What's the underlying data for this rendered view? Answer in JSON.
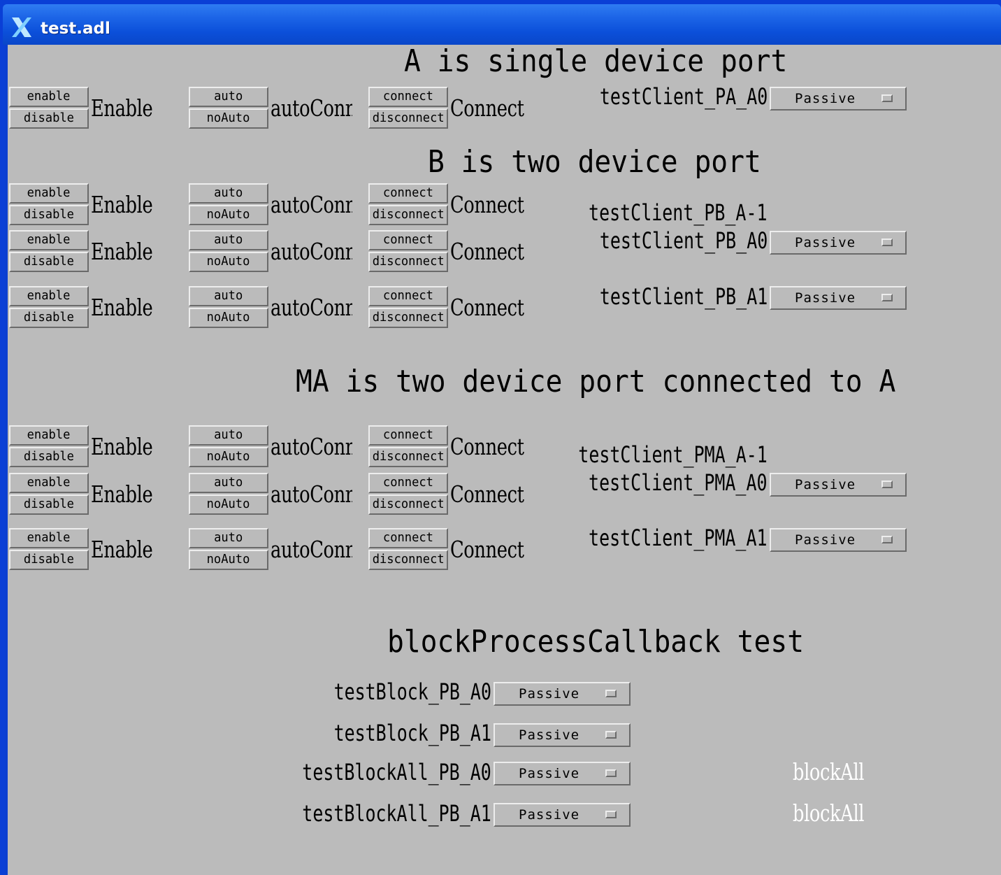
{
  "window": {
    "title": "test.adl",
    "icon": "x-window-icon"
  },
  "sections": {
    "a": "A is single device port",
    "b": "B is two device port",
    "ma": "MA is two device port connected to A",
    "block": "blockProcessCallback test"
  },
  "controls": {
    "enable": "enable",
    "disable": "disable",
    "enable_label": "Enable",
    "auto": "auto",
    "noauto": "noAuto",
    "autoconn_label": "autoConn",
    "connect": "connect",
    "disconnect": "disconnect",
    "connect_label": "Connect"
  },
  "records": {
    "pa_a0": "testClient_PA_A0",
    "pb_am1": "testClient_PB_A-1",
    "pb_a0": "testClient_PB_A0",
    "pb_a1": "testClient_PB_A1",
    "pma_am1": "testClient_PMA_A-1",
    "pma_a0": "testClient_PMA_A0",
    "pma_a1": "testClient_PMA_A1",
    "block_pb_a0": "testBlock_PB_A0",
    "block_pb_a1": "testBlock_PB_A1",
    "blockall_pb_a0": "testBlockAll_PB_A0",
    "blockall_pb_a1": "testBlockAll_PB_A1"
  },
  "menu_value": "Passive",
  "blockall_text": "blockAll",
  "colors": {
    "background": "#bbbbbb",
    "titlebar": "#1b63e6",
    "text": "#000000",
    "highlight_text": "#ffffff"
  }
}
